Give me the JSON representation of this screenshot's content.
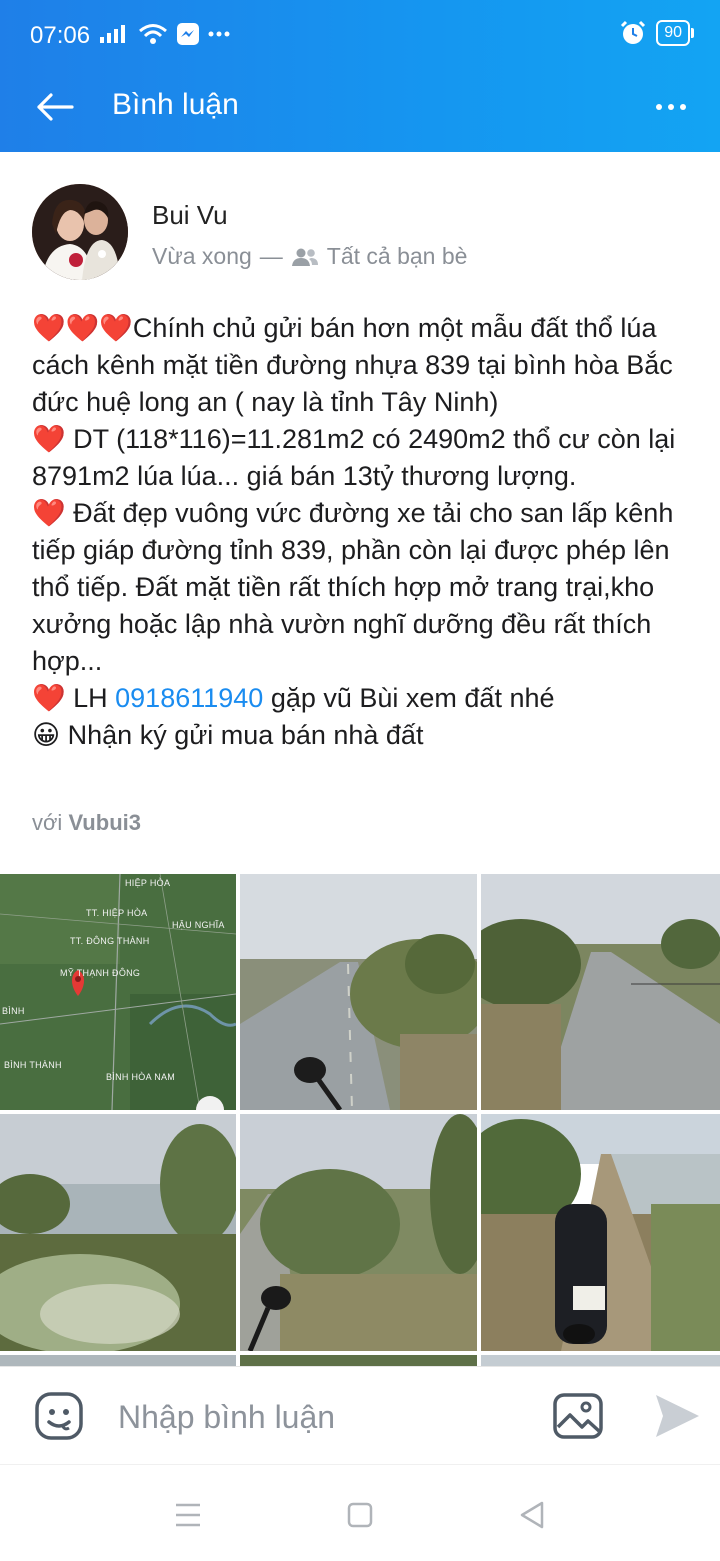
{
  "status_bar": {
    "time": "07:06",
    "battery": "90"
  },
  "app_bar": {
    "title": "Bình luận",
    "back_icon": "arrow-left-icon",
    "more_icon": "more-dots-icon"
  },
  "post": {
    "author": "Bui Vu",
    "time": "Vừa xong",
    "separator": "—",
    "audience": "Tất cả bạn bè",
    "line1": "❤️❤️❤️Chính chủ gửi bán hơn một mẫu đất thổ lúa cách kênh mặt tiền đường nhựa 839 tại bình hòa Bắc đức huệ long an ( nay là tỉnh Tây Ninh)",
    "line2": "❤️ DT (118*116)=11.281m2 có 2490m2 thổ cư còn lại 8791m2 lúa lúa... giá bán 13tỷ thương lượng.",
    "line3": "❤️ Đất đẹp vuông vức đường xe tải cho san lấp kênh tiếp giáp đường tỉnh 839, phần còn lại được phép lên thổ tiếp. Đất mặt tiền rất thích hợp mở trang trại,kho xưởng hoặc lập nhà vườn nghĩ dưỡng đều rất thích hợp...",
    "line4_prefix": "❤️ LH ",
    "phone": "0918611940",
    "line4_suffix": " gặp vũ Bùi xem đất nhé",
    "line5": "😀 Nhận ký gửi mua bán nhà đất",
    "with_label": "với",
    "tagged": "Vubui3"
  },
  "map_labels": {
    "hiep_hoa": "HIỆP HÒA",
    "tt_hiep_hoa": "TT. HIỆP HÒA",
    "tt_dong_thanh": "TT. ĐÔNG THÀNH",
    "hau_nghia": "HẬU NGHĨA",
    "my_thanh_dong": "MỸ THẠNH ĐÔNG",
    "binh": "BÌNH",
    "binh_thanh": "BÌNH THÀNH",
    "binh_hoa_nam": "BÌNH HÒA NAM"
  },
  "comment_bar": {
    "placeholder": "Nhập bình luận"
  },
  "colors": {
    "header_start": "#1f7fe8",
    "header_end": "#13a4f3",
    "link": "#1a8cf0",
    "muted": "#8a8f96"
  }
}
